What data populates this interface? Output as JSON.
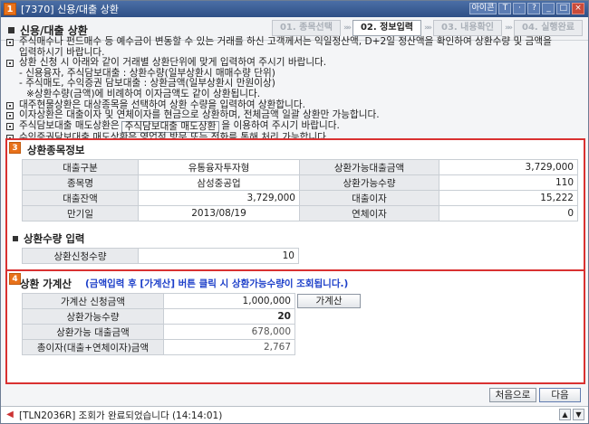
{
  "window": {
    "num": "1",
    "title": "[7370] 신용/대출 상환",
    "controls": [
      "아이콘",
      "T",
      "·",
      "?",
      "_",
      "□",
      "×"
    ]
  },
  "header": {
    "title": "신용/대출 상환",
    "steps": [
      {
        "label": "01. 종목선택",
        "active": false
      },
      {
        "label": "02. 정보입력",
        "active": true
      },
      {
        "label": "03. 내용확인",
        "active": false
      },
      {
        "label": "04. 실행완료",
        "active": false
      }
    ],
    "arrow": "»»"
  },
  "notes": {
    "n1a": "주식매수나 펀드매수 등 예수금이 변동할 수 있는 거래를 하신 고객께서는 익일정산액, D+2일 정산액을 확인하여 상환수량 및 금액을",
    "n1b": "입력하시기 바랍니다.",
    "n2": "상환 신청 시 아래와 같이 거래별 상환단위에 맞게 입력하여 주시기 바랍니다.",
    "n2a": "- 신용융자, 주식담보대출 : 상환수량(일부상환시 매매수량 단위)",
    "n2b": "- 주식매도, 수익증권 담보대출 : 상환금액(일부상환시 만원이상)",
    "n2c": "※상환수량(금액)에 비례하여 이자금액도 같이 상환됩니다.",
    "n3": "대주현물상환은 대상종목을 선택하여 상환 수량을 입력하여 상환합니다.",
    "n4": "이자상환은 대출이자 및 연체이자를 현금으로 상환하며, 전체금액 일괄 상환만 가능합니다.",
    "n5_pre": "주식담보대출 매도상환은",
    "n5_btn": "주식담보대출 매도상환",
    "n5_post": "을 이용하여 주시기 바랍니다.",
    "n6": "수익증권담보대출 매도상환은 영업점 방문 또는 전화를 통해 처리 가능합니다."
  },
  "info": {
    "badge": "3",
    "title": "상환종목정보",
    "rows": [
      {
        "l1": "대출구분",
        "v1": "유통융자투자형",
        "l2": "상환가능대출금액",
        "v2": "3,729,000"
      },
      {
        "l1": "종목명",
        "v1": "삼성중공업",
        "l2": "상환가능수량",
        "v2": "110"
      },
      {
        "l1": "대출잔액",
        "v1": "3,729,000",
        "l2": "대출이자",
        "v2": "15,222"
      },
      {
        "l1": "만기일",
        "v1": "2013/08/19",
        "l2": "연체이자",
        "v2": "0"
      }
    ]
  },
  "qty": {
    "title": "상환수량 입력",
    "label": "상환신청수량",
    "value": "10"
  },
  "calc": {
    "badge": "4",
    "title": "상환 가계산",
    "note": "(금액입력 후 [가계산] 버튼 클릭 시 상환가능수량이 조회됩니다.)",
    "button": "가계산",
    "rows": [
      {
        "label": "가계산 신청금액",
        "value": "1,000,000"
      },
      {
        "label": "상환가능수량",
        "value": "20"
      },
      {
        "label": "상환가능 대출금액",
        "value": "678,000"
      },
      {
        "label": "총이자(대출+연체이자)금액",
        "value": "2,767"
      }
    ]
  },
  "buttons": {
    "first": "처음으로",
    "next": "다음"
  },
  "status": {
    "text": "[TLN2036R] 조회가 완료되었습니다 (14:14:01)"
  }
}
